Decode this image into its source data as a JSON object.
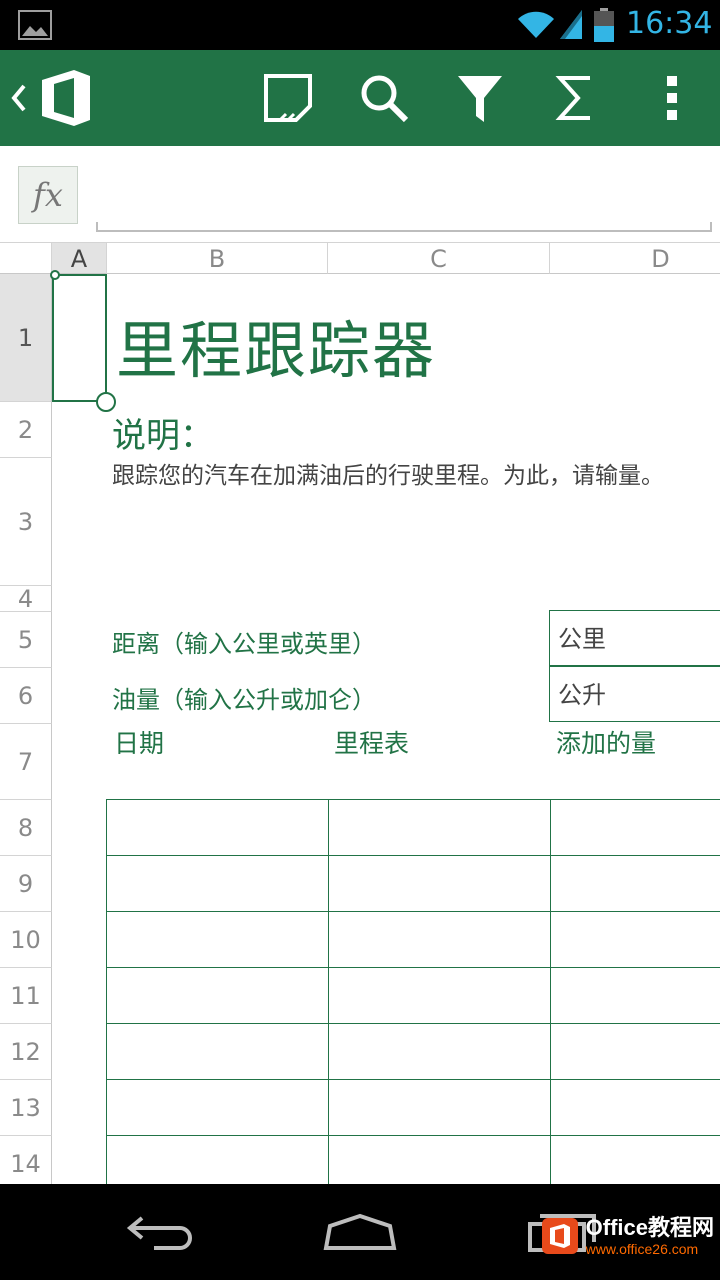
{
  "status_bar": {
    "time": "16:34",
    "icons": [
      "image-icon",
      "wifi-icon",
      "signal-icon",
      "battery-icon"
    ]
  },
  "app_bar": {
    "icons": [
      "back-icon",
      "office-logo-icon",
      "touch-mode-icon",
      "search-icon",
      "filter-icon",
      "sum-icon",
      "more-icon"
    ],
    "accent_color": "#217346"
  },
  "formula_bar": {
    "fx_label": "fx",
    "value": ""
  },
  "sheet": {
    "columns": [
      "A",
      "B",
      "C",
      "D"
    ],
    "rows": [
      "1",
      "2",
      "3",
      "4",
      "5",
      "6",
      "7",
      "8",
      "9",
      "10",
      "11",
      "12",
      "13",
      "14"
    ],
    "title": "里程跟踪器",
    "description_label": "说明：",
    "description_text": "跟踪您的汽车在加满油后的行驶里程。为此，请输量。",
    "distance_label": "距离（输入公里或英里）",
    "distance_unit": "公里",
    "volume_label": "油量（输入公升或加仑）",
    "volume_unit": "公升",
    "table_headers": [
      "日期",
      "里程表",
      "添加的量"
    ]
  },
  "watermark": {
    "title": "Office教程网",
    "url": "www.office26.com"
  }
}
